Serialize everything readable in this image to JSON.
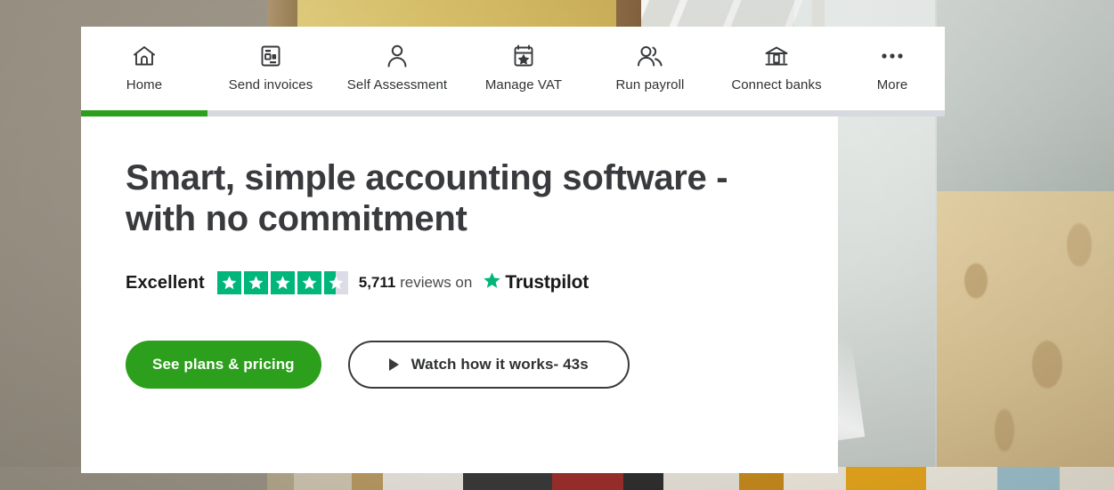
{
  "nav": {
    "items": [
      {
        "label": "Home",
        "icon": "home-icon",
        "active": true,
        "key": "home"
      },
      {
        "label": "Send invoices",
        "icon": "invoice-icon",
        "active": false,
        "key": "invoices"
      },
      {
        "label": "Self Assessment",
        "icon": "person-icon",
        "active": false,
        "key": "self"
      },
      {
        "label": "Manage VAT",
        "icon": "calendar-star-icon",
        "active": false,
        "key": "vat"
      },
      {
        "label": "Run payroll",
        "icon": "people-icon",
        "active": false,
        "key": "payroll"
      },
      {
        "label": "Connect banks",
        "icon": "bank-icon",
        "active": false,
        "key": "banks"
      },
      {
        "label": "More",
        "icon": "ellipsis-icon",
        "active": false,
        "key": "more"
      }
    ],
    "progress": {
      "fill_color": "#2ca01c",
      "track_color": "#d6d9de",
      "fill_percent": 15
    }
  },
  "hero": {
    "title": "Smart, simple accounting software - with no commitment",
    "trustpilot": {
      "rating_word": "Excellent",
      "stars_total": 5,
      "stars_filled": 4,
      "stars_half": 1,
      "review_count": "5,711",
      "reviews_suffix": "reviews on",
      "brand": "Trustpilot",
      "star_color": "#00b67a",
      "empty_star_color": "#dcdce6"
    },
    "cta": {
      "primary_label": "See plans & pricing",
      "primary_color": "#2ca01c",
      "secondary_label": "Watch how it works- 43s",
      "secondary_icon": "play-icon"
    }
  },
  "theme": {
    "accent_green": "#2ca01c",
    "text_dark": "#393a3d",
    "panel_white": "#ffffff",
    "background_tan": "#9b9486"
  }
}
